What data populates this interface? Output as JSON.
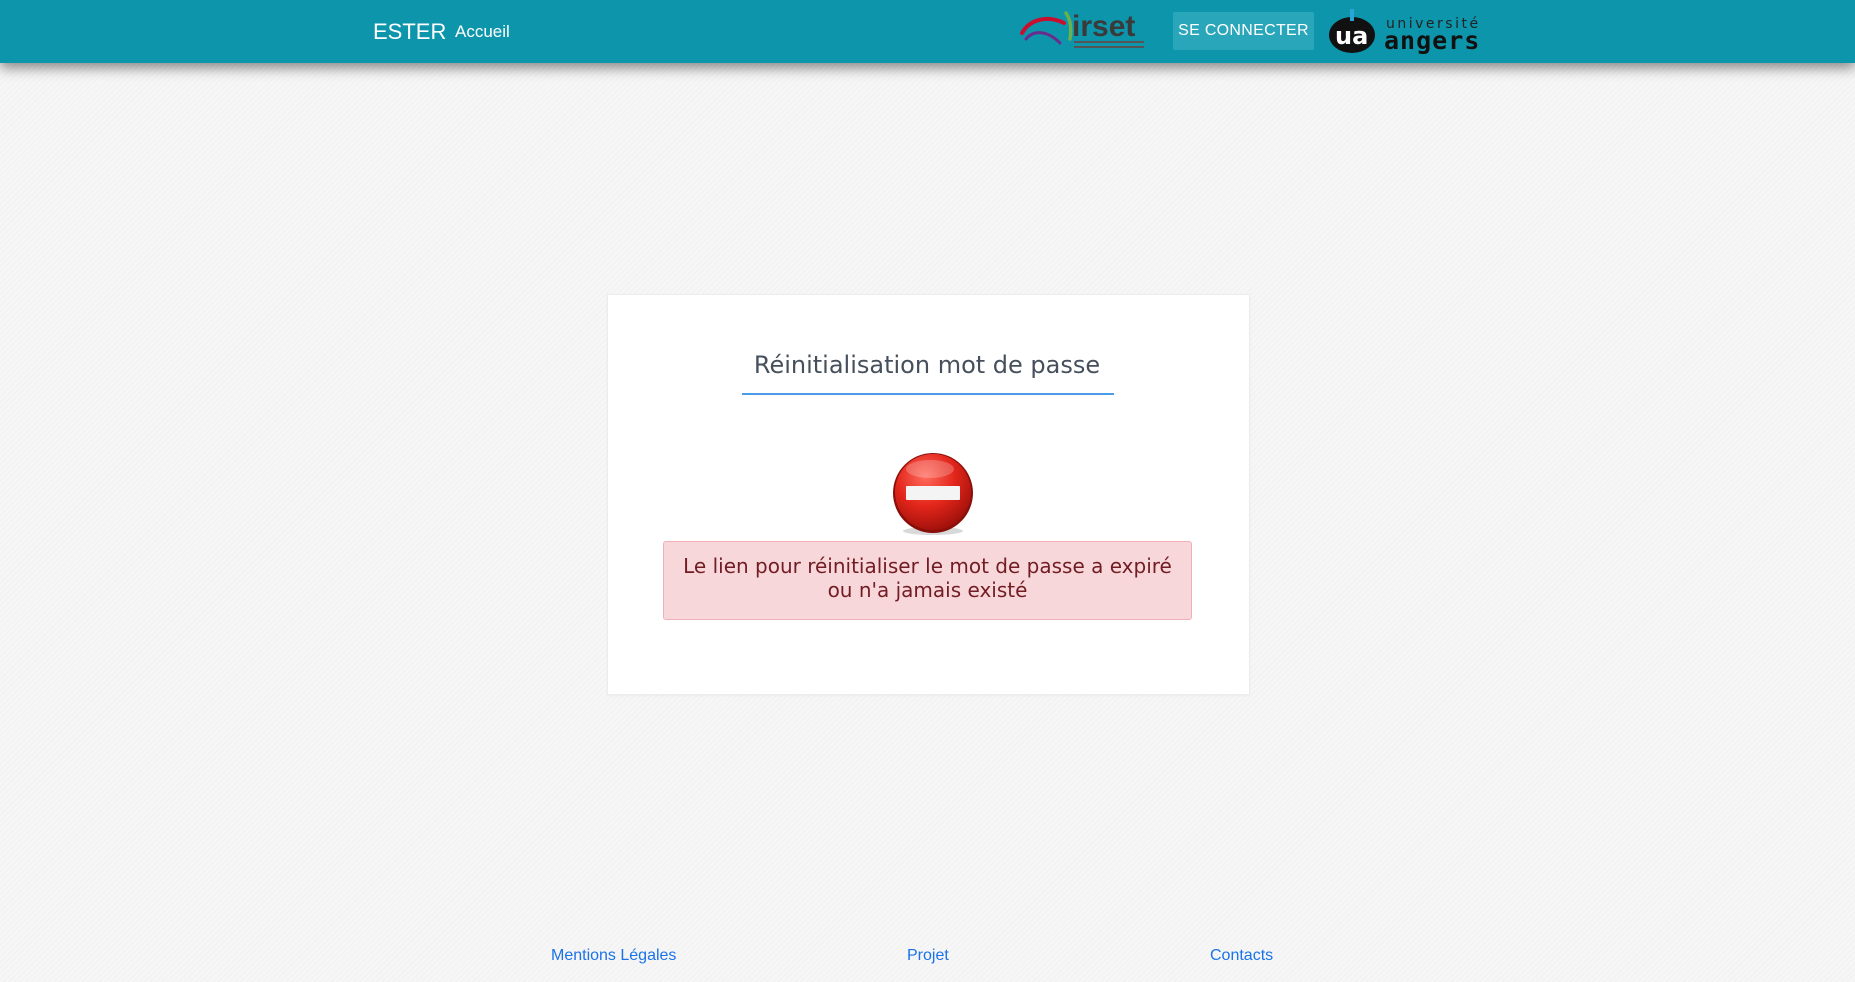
{
  "navbar": {
    "brand": "ESTER",
    "home_link": "Accueil",
    "irset_logo_text": "irset",
    "login_button": "SE CONNECTER",
    "ua_logo_top": "université",
    "ua_logo_bottom": "angers",
    "ua_logo_mark": "ua",
    "colors": {
      "bar": "#0c95ab",
      "button": "#2aa6bb"
    }
  },
  "card": {
    "title": "Réinitialisation mot de passe",
    "icon": "stop-icon",
    "alert_line1": "Le lien pour réinitialiser le mot de passe a expiré",
    "alert_line2": "ou n'a jamais existé",
    "colors": {
      "alert_bg": "#f8d7da",
      "alert_text": "#721c24",
      "underline": "#4c9be8"
    }
  },
  "footer": {
    "links": [
      "Mentions Légales",
      "Projet",
      "Contacts"
    ]
  }
}
